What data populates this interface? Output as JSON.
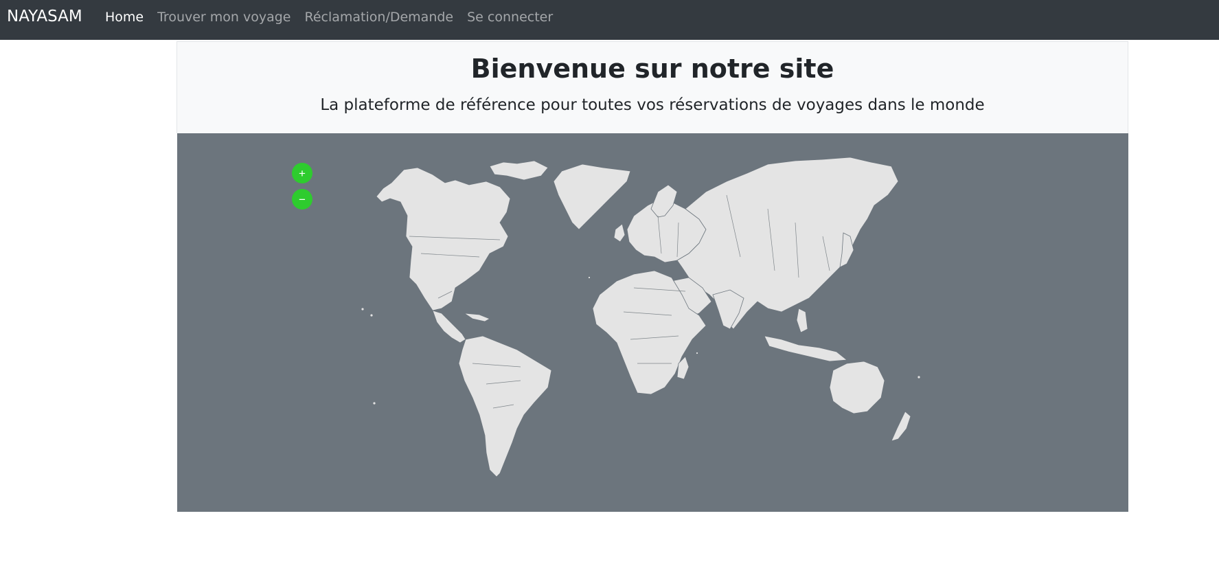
{
  "navbar": {
    "brand": "NAYASAM",
    "links": [
      {
        "label": "Home",
        "active": true
      },
      {
        "label": "Trouver mon voyage",
        "active": false
      },
      {
        "label": "Réclamation/Demande",
        "active": false
      },
      {
        "label": "Se connecter",
        "active": false
      }
    ]
  },
  "hero": {
    "title": "Bienvenue sur notre site",
    "subtitle": "La plateforme de référence pour toutes vos réservations de voyages dans le monde"
  },
  "map": {
    "zoom_in_label": "+",
    "zoom_out_label": "−",
    "zoom_in_icon": "plus-icon",
    "zoom_out_icon": "minus-icon",
    "colors": {
      "ocean": "#6c757d",
      "land": "#e4e4e4",
      "zoom_buttons": "#2ecc2e"
    }
  },
  "colors": {
    "navbar_bg": "#343a40",
    "jumbotron_bg": "#f8f9fa"
  }
}
